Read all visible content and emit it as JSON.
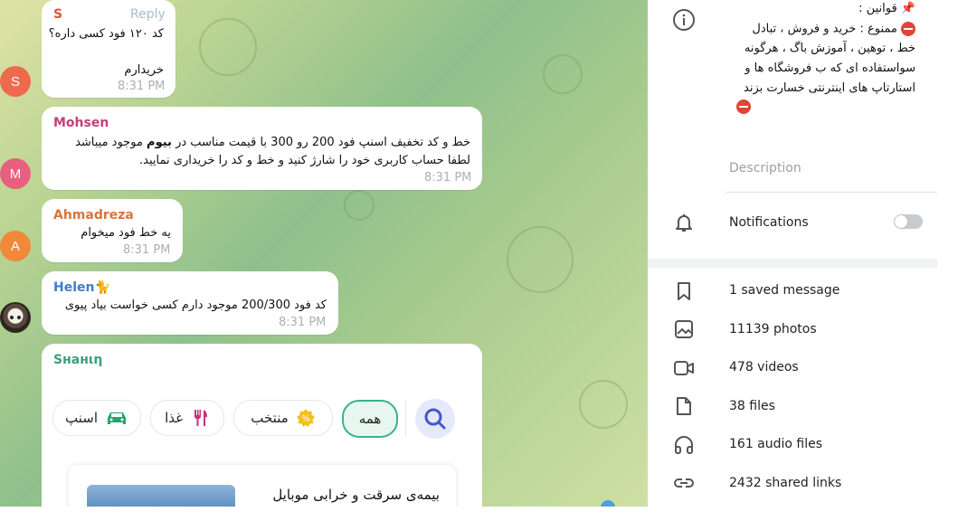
{
  "messages": [
    {
      "sender": "S",
      "avatar_letter": "S",
      "reply_label": "Reply",
      "lines": [
        "کد ۱۲۰ فود کسی داره؟",
        "",
        "خریدارم"
      ],
      "time": "8:31 PM"
    },
    {
      "sender": "Mohsen",
      "avatar_letter": "M",
      "line1_pre": "خط و کد تخفیف اسنپ فود 200 رو 300 با قیمت مناسب در",
      "line1_bold": "بیوم",
      "line1_post": "موجود میباشد",
      "line2": "لطفا حساب کاربری خود را شارژ کنید و خط و کد را خریداری نمایید.",
      "time": "8:31 PM"
    },
    {
      "sender": "Ahmadreza",
      "avatar_letter": "A",
      "line1": "یه خط فود میخوام",
      "time": "8:31 PM"
    },
    {
      "sender": "Helen🐈",
      "line1": "کد فود 200/300 موجود دارم کسی خواست بیاد پیوی",
      "time": "8:31 PM"
    }
  ],
  "widget": {
    "sender": "Sнанιη",
    "chips": [
      "همه",
      "منتخب",
      "غذا",
      "اسنپ"
    ],
    "card_title": "بیمه‌ی سرقت و خرابی موبایل"
  },
  "panel": {
    "rules_title": "قوانین :",
    "rules_line1": "ممنوع : خرید و فروش ، تبادل",
    "rules_line2": "خط ، توهین ، آموزش باگ ، هرگونه",
    "rules_line3": "سواستفاده ای که ب فروشگاه ها و",
    "rules_line4": "استارتاپ های اینترنتی خسارت بزند",
    "description_label": "Description",
    "notifications_label": "Notifications",
    "media": [
      {
        "icon": "bookmark-icon",
        "label": "1 saved message"
      },
      {
        "icon": "photo-icon",
        "label": "11139 photos"
      },
      {
        "icon": "video-icon",
        "label": "478 videos"
      },
      {
        "icon": "file-icon",
        "label": "38 files"
      },
      {
        "icon": "headphones-icon",
        "label": "161 audio files"
      },
      {
        "icon": "link-icon",
        "label": "2432 shared links"
      }
    ]
  },
  "colors": {
    "sender_s": "#e0533c",
    "sender_mohsen": "#c2407a",
    "sender_ahmadreza": "#d9743a",
    "sender_helen": "#3f7ccb",
    "sender_shahin": "#3aa07a",
    "avatar_s": "#ee6a4f",
    "avatar_m": "#e8607d",
    "avatar_a": "#f08a3a"
  }
}
